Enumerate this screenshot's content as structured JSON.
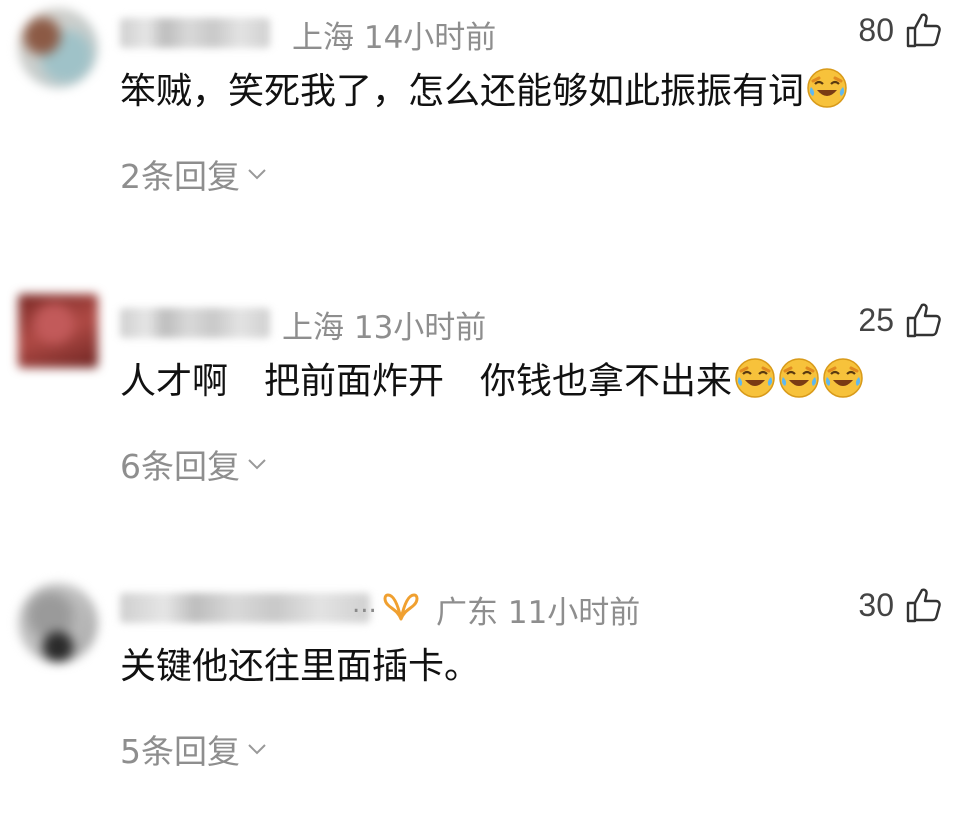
{
  "comments": [
    {
      "location_time": "上海 14小时前",
      "likes": "80",
      "text": "笨贼，笑死我了，怎么还能够如此振振有词",
      "emojis": [
        "laughing-crying-emoji"
      ],
      "replies": "2条回复"
    },
    {
      "location_time": "上海 13小时前",
      "likes": "25",
      "text": "人才啊　把前面炸开　你钱也拿不出来",
      "emojis": [
        "laughing-crying-emoji",
        "laughing-crying-emoji",
        "laughing-crying-emoji"
      ],
      "replies": "6条回复"
    },
    {
      "ellipsis": "...",
      "location_time": "广东 11小时前",
      "likes": "30",
      "text": "关键他还往里面插卡。",
      "emojis": [],
      "replies": "5条回复"
    }
  ],
  "colors": {
    "meta_gray": "#8e8e8e",
    "text": "#111111",
    "vip_orange": "#f0a030"
  }
}
